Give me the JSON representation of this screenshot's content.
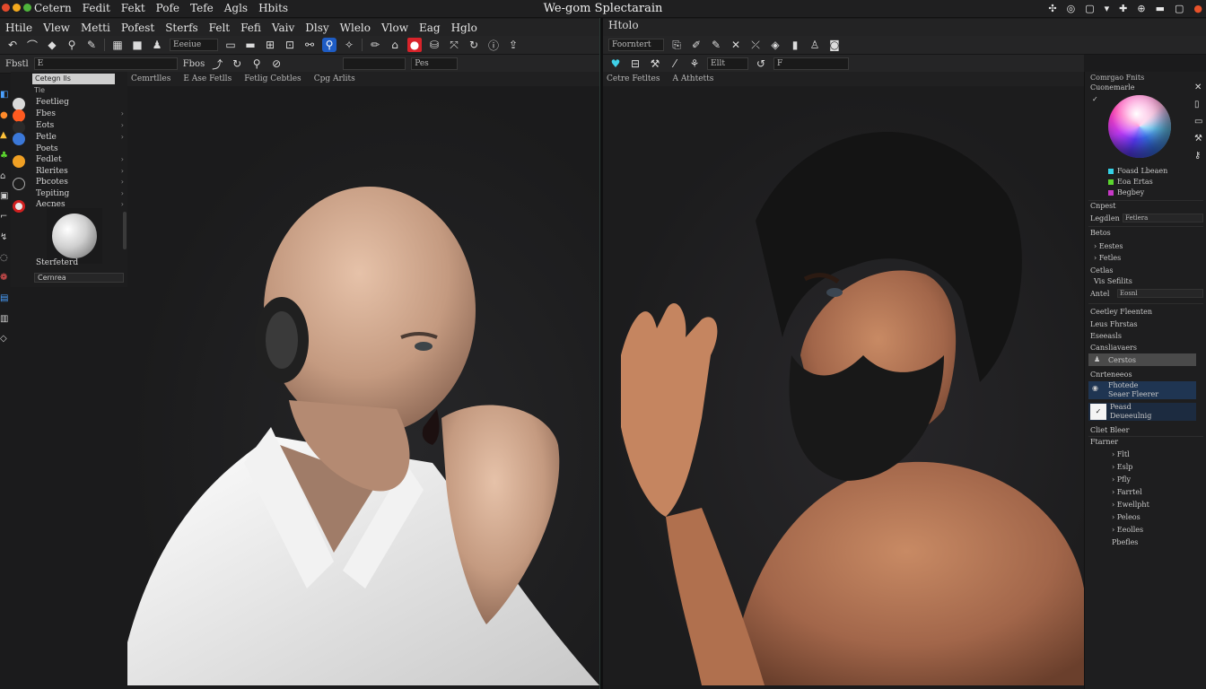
{
  "window": {
    "title": "We-gom Splectarain",
    "title_menu": [
      "Cetern",
      "Fedit",
      "Fekt",
      "Pofe",
      "Tefe",
      "Agls",
      "Hbits"
    ],
    "controls": [
      "✣",
      "◎",
      "▢",
      "▾",
      "✚",
      "⊕",
      "▬",
      "▢",
      "●"
    ]
  },
  "menu_left": [
    "Htile",
    "Vlew",
    "Metti",
    "Pofest",
    "Sterfs",
    "Felt",
    "Fefi",
    "Vaiv",
    "Dlsy",
    "Wlelo",
    "Vlow",
    "Eag",
    "Hglo"
  ],
  "menu_right": [
    "Htolo"
  ],
  "toolbar_left": {
    "field1": "Eeeiue",
    "row2_label": "Fbstl",
    "row2_field": "E",
    "row2_label2": "Fbos",
    "row2_field2": "Pes"
  },
  "tabs_left": [
    "Cemrtlles",
    "E Ase Fetlls",
    "Fetlig Cebtles",
    "Cpg Arlits"
  ],
  "toolbar_right": {
    "field1": "Foorntert",
    "field2": "Ellt",
    "field3": "F"
  },
  "tabs_right": [
    "Cetre Fetltes",
    "A Athtetts"
  ],
  "outliner": {
    "search": "Cetegn lls",
    "header": "Tle",
    "items": [
      "Feetlieg",
      "Fbes",
      "Eots",
      "Petle",
      "Poets",
      "Fedlet",
      "Rlerites",
      "Pbcotes",
      "Tepiting",
      "Aecnes"
    ],
    "thumb_label": "Sterfeterd",
    "camera_select": "Cernrea"
  },
  "props": {
    "header": "Comrgao Fnits",
    "sub": "Cuonemarle",
    "swatches": [
      {
        "label": "Foasd Lbeaen",
        "color": "#35d0e6"
      },
      {
        "label": "Eoa Ertas",
        "color": "#5bd62e"
      },
      {
        "label": "Begbey",
        "color": "#c738c7"
      }
    ],
    "sec1": "Cnpest",
    "sec1_field_label": "Legdlen",
    "sec1_field": "Fetlera",
    "sec2": "Betos",
    "sec2_items": [
      "Eestes",
      "Fetles"
    ],
    "sec3": "Cetlas",
    "sec3_item": "Vis Sefilits",
    "sec3_field_label": "Antel",
    "sec3_field": "Eosnl",
    "sec4": "Ceetley Fleenten",
    "sec4b": "Leus Fhrstas",
    "sec4c": "Eseeasls",
    "sec5": "Cansliavaers",
    "sel_row": "Cerstos",
    "sec6": "Cnrteneeos",
    "blue_row1_a": "Fhotede",
    "blue_row1_b": "Seaer Fleerer",
    "blue_row2_a": "Peasd",
    "blue_row2_b": "Deueeulnig",
    "sec7": "Cliet Bleer",
    "sec8": "Ftarner",
    "tree": [
      "Fltl",
      "Eslp",
      "Pfly",
      "Farrtel",
      "Ewellpht",
      "Peleos",
      "Eeolles",
      "Pbefles"
    ]
  },
  "accent_colors": {
    "selected_blue": "#1e5cc4",
    "red_tool": "#d8232a",
    "cyan_tool": "#3fd0e8"
  }
}
